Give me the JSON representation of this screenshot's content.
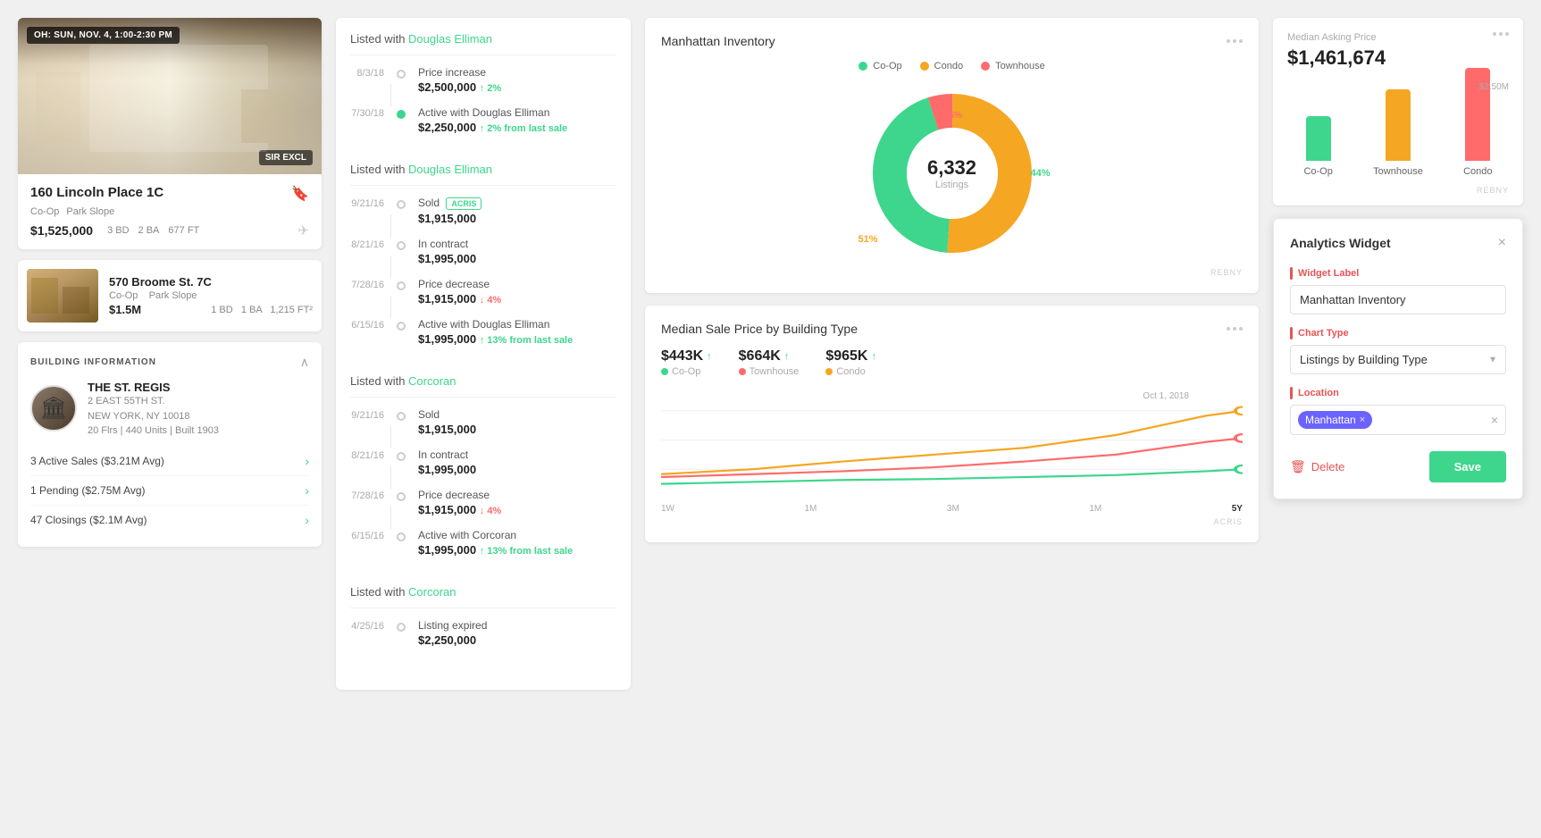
{
  "col1": {
    "listing1": {
      "oh_badge": "OH: SUN, NOV. 4, 1:00-2:30 PM",
      "excl_badge": "SIR EXCL",
      "address": "160 Lincoln Place 1C",
      "type": "Co-Op",
      "neighborhood": "Park Slope",
      "price": "$1,525,000",
      "beds": "3 BD",
      "baths": "2 BA",
      "sqft": "677 FT"
    },
    "listing2": {
      "address": "570 Broome St. 7C",
      "type": "Co-Op",
      "neighborhood": "Park Slope",
      "price": "$1.5M",
      "beds": "1 BD",
      "baths": "1 BA",
      "sqft": "1,215 FT²"
    },
    "building": {
      "section_title": "BUILDING INFORMATION",
      "name": "THE ST. REGIS",
      "address_line1": "2 EAST 55TH ST.",
      "address_line2": "NEW YORK, NY 10018",
      "stats": "20 Flrs | 440 Units | Built 1903",
      "stat1": "3 Active Sales ($3.21M Avg)",
      "stat2": "1 Pending ($2.75M Avg)",
      "stat3": "47 Closings ($2.1M Avg)"
    }
  },
  "col2": {
    "groups": [
      {
        "agent_prefix": "Listed with",
        "agent_name": "Douglas Elliman",
        "items": [
          {
            "date": "8/3/18",
            "event": "Price increase",
            "price": "$2,500,000",
            "change": "↑ 2%",
            "change_type": "up",
            "dot_active": true
          },
          {
            "date": "7/30/18",
            "event": "Active with Douglas Elliman",
            "price": "$2,250,000",
            "change": "↑ 2% from last sale",
            "change_type": "up",
            "dot_active": true
          }
        ]
      },
      {
        "agent_prefix": "Listed with",
        "agent_name": "Douglas Elliman",
        "items": [
          {
            "date": "9/21/16",
            "event": "Sold",
            "price": "$1,915,000",
            "change": "",
            "change_type": "",
            "dot_active": false,
            "badge": "ACRIS"
          },
          {
            "date": "8/21/16",
            "event": "In contract",
            "price": "$1,995,000",
            "change": "",
            "change_type": "",
            "dot_active": false
          },
          {
            "date": "7/28/16",
            "event": "Price decrease",
            "price": "$1,915,000",
            "change": "↓ 4%",
            "change_type": "down",
            "dot_active": false
          },
          {
            "date": "6/15/16",
            "event": "Active with Douglas Elliman",
            "price": "$1,995,000",
            "change": "↑ 13% from last sale",
            "change_type": "up",
            "dot_active": false
          }
        ]
      },
      {
        "agent_prefix": "Listed with",
        "agent_name": "Corcoran",
        "items": [
          {
            "date": "9/21/16",
            "event": "Sold",
            "price": "$1,915,000",
            "change": "",
            "change_type": "",
            "dot_active": false
          },
          {
            "date": "8/21/16",
            "event": "In contract",
            "price": "$1,995,000",
            "change": "",
            "change_type": "",
            "dot_active": false
          },
          {
            "date": "7/28/16",
            "event": "Price decrease",
            "price": "$1,915,000",
            "change": "↓ 4%",
            "change_type": "down",
            "dot_active": false
          },
          {
            "date": "6/15/16",
            "event": "Active with Corcoran",
            "price": "$1,995,000",
            "change": "↑ 13% from last sale",
            "change_type": "up",
            "dot_active": false
          }
        ]
      },
      {
        "agent_prefix": "Listed with",
        "agent_name": "Corcoran",
        "items": [
          {
            "date": "4/25/16",
            "event": "Listing expired",
            "price": "$2,250,000",
            "change": "",
            "change_type": "",
            "dot_active": false
          }
        ]
      }
    ]
  },
  "col3": {
    "donut_chart": {
      "title": "Manhattan Inventory",
      "center_number": "6,332",
      "center_label": "Listings",
      "segments": {
        "coop_pct": 44,
        "condo_pct": 51,
        "townhouse_pct": 5
      },
      "legend": [
        {
          "label": "Co-Op",
          "color": "#3DD68C"
        },
        {
          "label": "Condo",
          "color": "#F5A623"
        },
        {
          "label": "Townhouse",
          "color": "#FF6B6B"
        }
      ],
      "rebny_label": "REBNY"
    },
    "line_chart": {
      "title": "Median Sale Price by Building Type",
      "stats": [
        {
          "value": "$443K",
          "label": "Co-Op",
          "color": "#3DD68C"
        },
        {
          "value": "$664K",
          "label": "Townhouse",
          "color": "#FF6B6B"
        },
        {
          "value": "$965K",
          "label": "Condo",
          "color": "#F5A623"
        }
      ],
      "date_label": "Oct 1, 2018",
      "x_labels": [
        "1W",
        "1M",
        "3M",
        "1M",
        "5Y"
      ],
      "acris_label": "ACRIS"
    }
  },
  "col4": {
    "bar_chart": {
      "title": "Median Asking Price",
      "price": "$1,461,674",
      "max_label": "$2.50M",
      "bars": [
        {
          "label": "Co-Op",
          "height_pct": 45,
          "color": "#3DD68C"
        },
        {
          "label": "Townhouse",
          "height_pct": 72,
          "color": "#F5A623"
        },
        {
          "label": "Condo",
          "height_pct": 95,
          "color": "#FF6B6B"
        }
      ],
      "rebny_label": "REBNY"
    },
    "widget": {
      "title": "Analytics Widget",
      "close_label": "×",
      "widget_label_field": "Widget Label",
      "widget_label_value": "Manhattan Inventory",
      "chart_type_field": "Chart Type",
      "chart_type_value": "Listings by Building Type",
      "location_field": "Location",
      "location_tag": "Manhattan",
      "delete_label": "Delete",
      "save_label": "Save"
    }
  }
}
